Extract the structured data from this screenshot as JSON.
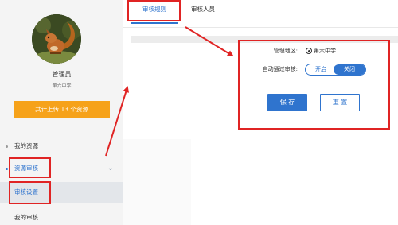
{
  "sidebar": {
    "user_name": "管理员",
    "school": "第六中学",
    "upload_button": "共计上传 13 个资源",
    "menu": [
      {
        "label": "我的资源"
      },
      {
        "label": "资源审核",
        "expanded": true,
        "children": [
          {
            "label": "审核设置",
            "selected": true
          },
          {
            "label": "我的审核"
          }
        ]
      }
    ]
  },
  "tabs": [
    {
      "label": "审核规则",
      "active": true
    },
    {
      "label": "审核人员",
      "active": false
    }
  ],
  "form": {
    "region_label": "管理地区:",
    "region_value": "第六中学",
    "auto_label": "自动通过审核:",
    "toggle_on": "开启",
    "toggle_off": "关闭",
    "toggle_state": "关闭",
    "save_button": "保 存",
    "reset_button": "重 置"
  },
  "colors": {
    "accent": "#2f74ce",
    "upload_orange": "#f6a21a",
    "annotation_red": "#e02424"
  },
  "icons": [
    "chevron-down-icon",
    "avatar-squirrel",
    "arrow-annotation"
  ]
}
